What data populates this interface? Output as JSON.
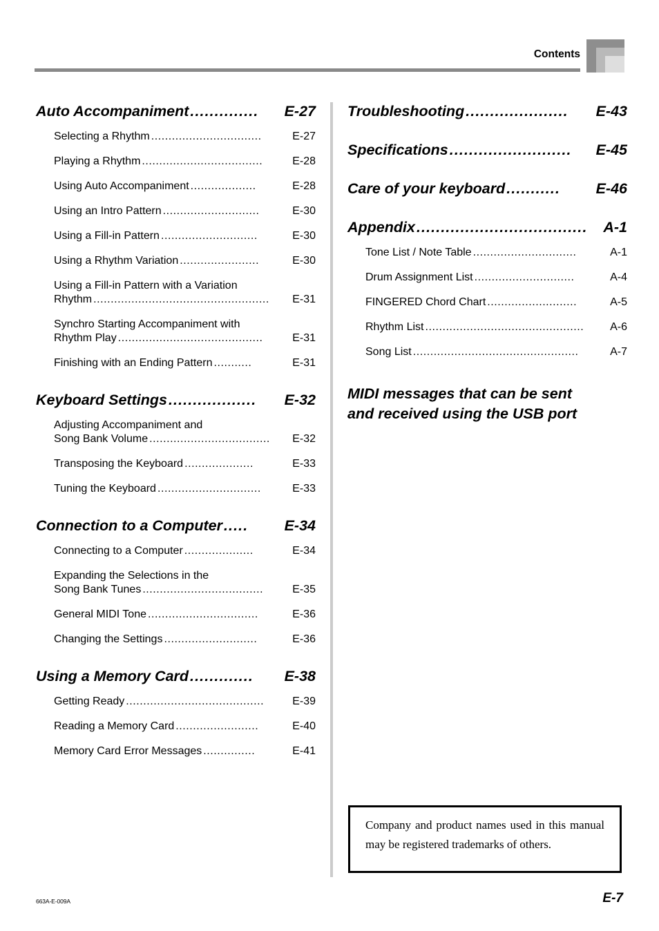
{
  "header": {
    "label": "Contents"
  },
  "left_column": [
    {
      "type": "chapter",
      "title": "Auto Accompaniment",
      "dots": "..............",
      "page": "E-27"
    },
    {
      "type": "item",
      "title": "Selecting a Rhythm",
      "dots": "................................",
      "page": "E-27"
    },
    {
      "type": "item",
      "title": "Playing a Rhythm",
      "dots": "...................................",
      "page": "E-28"
    },
    {
      "type": "item",
      "title": "Using Auto Accompaniment",
      "dots": "...................",
      "page": "E-28"
    },
    {
      "type": "item",
      "title": "Using an Intro Pattern",
      "dots": "............................",
      "page": "E-30"
    },
    {
      "type": "item",
      "title": "Using a Fill-in Pattern",
      "dots": "............................",
      "page": "E-30"
    },
    {
      "type": "item",
      "title": "Using a Rhythm Variation",
      "dots": ".......................",
      "page": "E-30"
    },
    {
      "type": "item2",
      "line1": "Using a Fill-in Pattern with a Variation",
      "title": "Rhythm",
      "dots": "...................................................",
      "page": "E-31"
    },
    {
      "type": "item2",
      "line1": "Synchro Starting Accompaniment with",
      "title": "Rhythm Play",
      "dots": "..........................................",
      "page": "E-31"
    },
    {
      "type": "item",
      "title": "Finishing with an Ending Pattern",
      "dots": "...........",
      "page": "E-31"
    },
    {
      "type": "chapter",
      "title": "Keyboard Settings",
      "dots": "..................",
      "page": "E-32"
    },
    {
      "type": "item2",
      "line1": "Adjusting Accompaniment and",
      "title": "Song Bank Volume",
      "dots": "...................................",
      "page": "E-32"
    },
    {
      "type": "item",
      "title": "Transposing the Keyboard",
      "dots": "....................",
      "page": "E-33"
    },
    {
      "type": "item",
      "title": "Tuning the Keyboard",
      "dots": "..............................",
      "page": "E-33"
    },
    {
      "type": "chapter",
      "title": "Connection to a Computer",
      "dots": ".....",
      "page": "E-34"
    },
    {
      "type": "item",
      "title": "Connecting to a Computer",
      "dots": "....................",
      "page": "E-34"
    },
    {
      "type": "item2",
      "line1": "Expanding the Selections in the",
      "title": "Song Bank Tunes",
      "dots": "...................................",
      "page": "E-35"
    },
    {
      "type": "item",
      "title": "General MIDI Tone",
      "dots": "................................",
      "page": "E-36"
    },
    {
      "type": "item",
      "title": "Changing the Settings",
      "dots": "...........................",
      "page": "E-36"
    },
    {
      "type": "chapter",
      "title": "Using a Memory Card",
      "dots": ".............",
      "page": "E-38"
    },
    {
      "type": "item",
      "title": "Getting Ready",
      "dots": "........................................",
      "page": "E-39"
    },
    {
      "type": "item",
      "title": "Reading a Memory Card",
      "dots": "........................",
      "page": "E-40"
    },
    {
      "type": "item",
      "title": "Memory Card Error Messages",
      "dots": "...............",
      "page": "E-41"
    }
  ],
  "right_column": [
    {
      "type": "chapter",
      "title": "Troubleshooting",
      "dots": ".....................",
      "page": "E-43"
    },
    {
      "type": "chapter",
      "title": "Specifications",
      "dots": ".........................",
      "page": "E-45"
    },
    {
      "type": "chapter",
      "title": "Care of your keyboard",
      "dots": "...........",
      "page": "E-46"
    },
    {
      "type": "chapter",
      "title": "Appendix",
      "dots": "...................................",
      "page": "A-1"
    },
    {
      "type": "item",
      "title": "Tone List / Note Table",
      "dots": "..............................",
      "page": "A-1"
    },
    {
      "type": "item",
      "title": "Drum Assignment List",
      "dots": ".............................",
      "page": "A-4"
    },
    {
      "type": "item",
      "title": "FINGERED Chord Chart",
      "dots": "..........................",
      "page": "A-5"
    },
    {
      "type": "item",
      "title": "Rhythm List",
      "dots": "..............................................",
      "page": "A-6"
    },
    {
      "type": "item",
      "title": "Song List",
      "dots": "................................................",
      "page": "A-7"
    },
    {
      "type": "chapter_plain",
      "line1": "MIDI messages that can be sent",
      "line2": "and received using the USB port"
    }
  ],
  "notice": {
    "text": "Company and product names used in this manual may be registered trademarks of others."
  },
  "footer": {
    "code": "663A-E-009A",
    "page": "E-7"
  }
}
